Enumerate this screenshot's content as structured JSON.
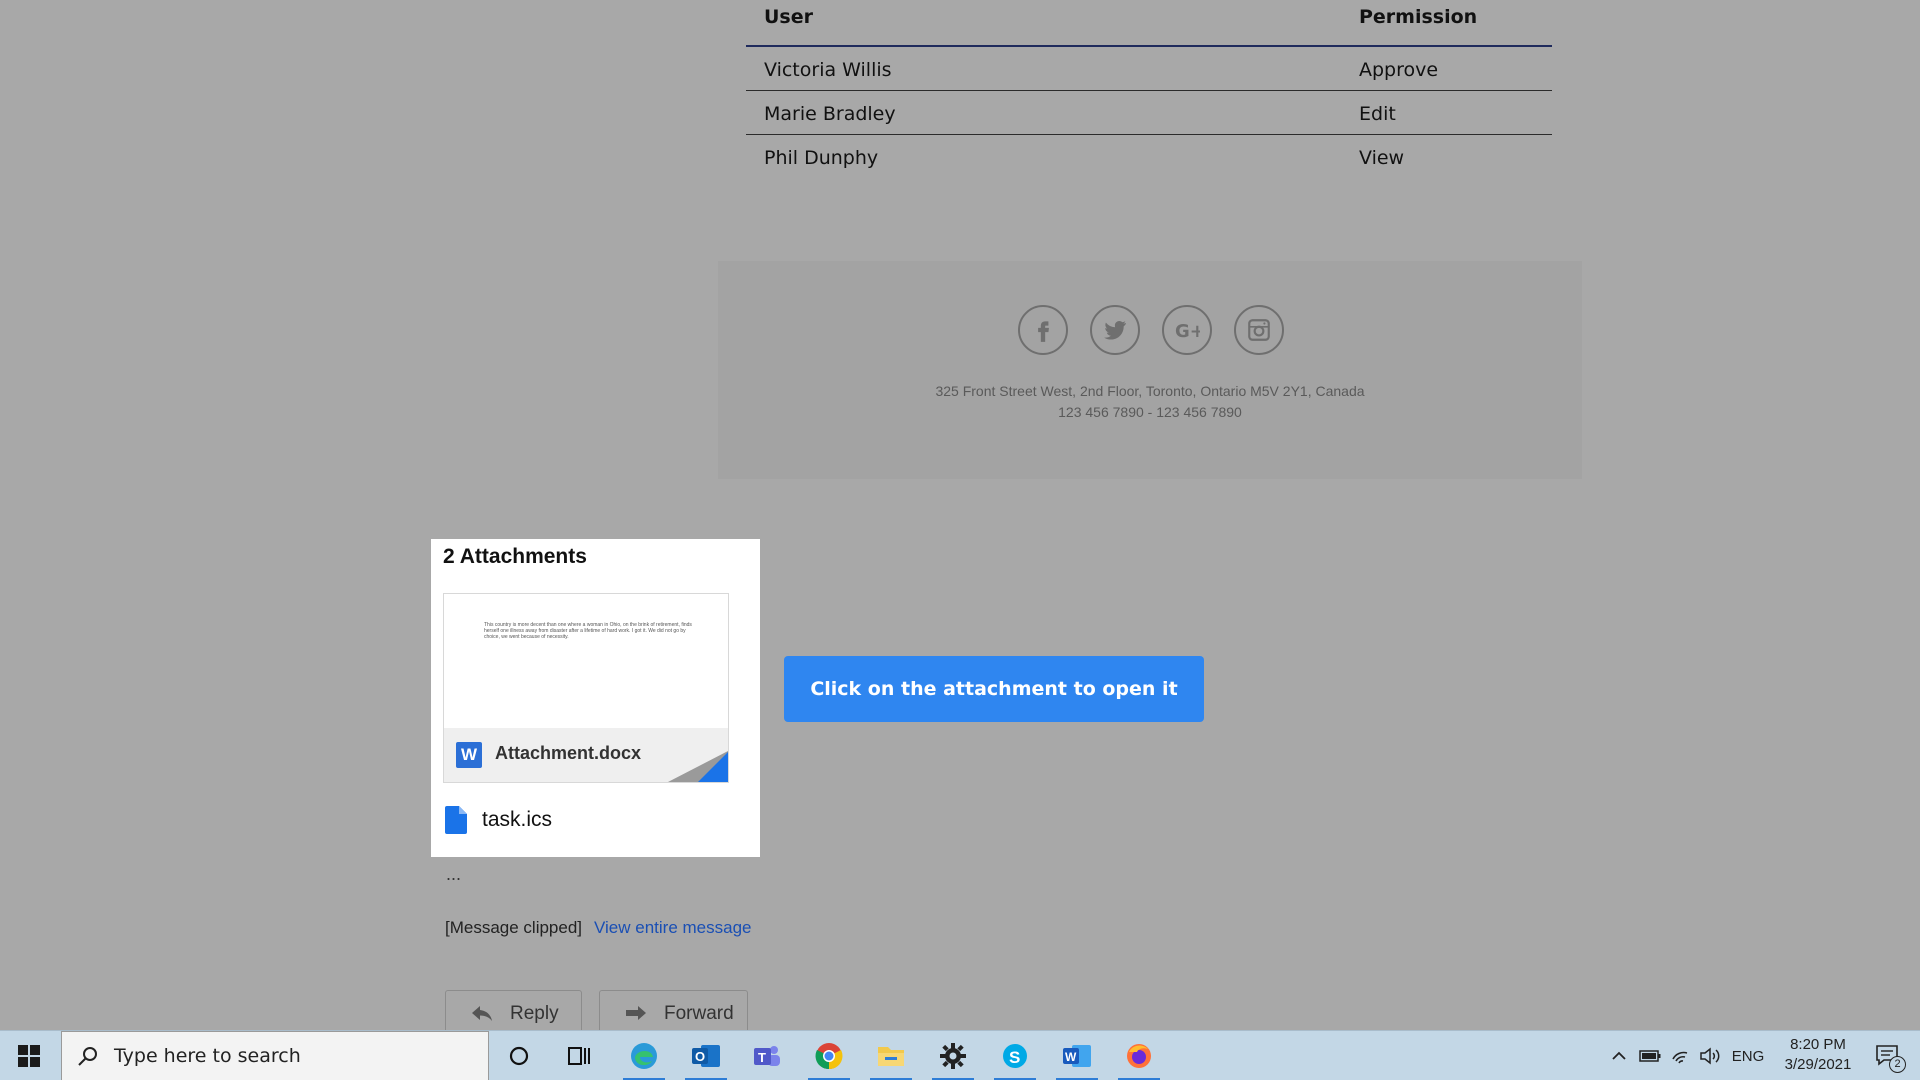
{
  "table": {
    "headers": {
      "user": "User",
      "permission": "Permission"
    },
    "rows": [
      {
        "user": "Victoria Willis",
        "permission": "Approve"
      },
      {
        "user": "Marie Bradley",
        "permission": "Edit"
      },
      {
        "user": "Phil Dunphy",
        "permission": "View"
      }
    ]
  },
  "footer": {
    "socials": [
      "facebook-icon",
      "twitter-icon",
      "google-plus-icon",
      "instagram-icon"
    ],
    "address": "325 Front Street West, 2nd Floor, Toronto, Ontario M5V 2Y1, Canada",
    "phones": "123 456 7890 - 123 456 7890"
  },
  "attachments": {
    "title": "2 Attachments",
    "preview_text": "This country is more decent than one where a woman in Ohio, on the brink of retirement, finds herself one illness away from disaster after a lifetime of hard work. I got it. We did not go by choice, we went because of necessity.",
    "docx_name": "Attachment.docx",
    "ics_name": "task.ics"
  },
  "hint": "Click on the attachment to open it",
  "message": {
    "ellipsis": "...",
    "clipped": "[Message clipped]",
    "view_entire": "View entire message",
    "reply": "Reply",
    "forward": "Forward"
  },
  "taskbar": {
    "search_placeholder": "Type here to search",
    "language": "ENG",
    "time": "8:20 PM",
    "date": "3/29/2021",
    "notification_count": "2"
  },
  "colors": {
    "accent": "#2f86f0",
    "link": "#1a4fb4",
    "taskbar": "#c3d7e6"
  }
}
